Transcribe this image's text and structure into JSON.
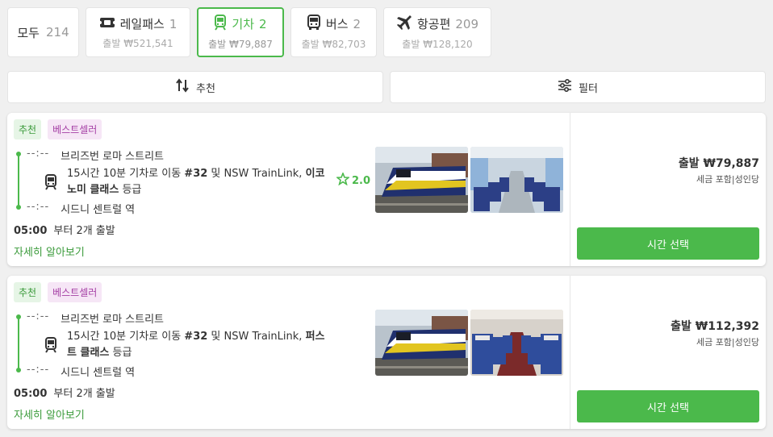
{
  "tabs": [
    {
      "label": "모두",
      "count": "214"
    },
    {
      "label": "레일패스",
      "count": "1",
      "sub": "출발 ₩521,541",
      "icon": "ticket-icon"
    },
    {
      "label": "기차",
      "count": "2",
      "sub": "출발 ₩79,887",
      "icon": "train-icon",
      "active": true
    },
    {
      "label": "버스",
      "count": "2",
      "sub": "출발 ₩82,703",
      "icon": "bus-icon"
    },
    {
      "label": "항공편",
      "count": "209",
      "sub": "출발 ₩128,120",
      "icon": "plane-icon"
    }
  ],
  "toolbar": {
    "sort_label": "추천",
    "filter_label": "필터"
  },
  "results": [
    {
      "badges": [
        "추천",
        "베스트셀러"
      ],
      "from": {
        "time": "--:--",
        "station": "브리즈번 로마 스트리트"
      },
      "to": {
        "time": "--:--",
        "station": "시드니 센트럴 역"
      },
      "journey_pre": "15시간 10분 기차로 이동 ",
      "train_no": "#32",
      "journey_mid": " 및 NSW TrainLink, ",
      "class_name": "이코노미 클래스",
      "journey_post": " 등급",
      "rating": "2.0",
      "depart_time": "05:00",
      "depart_text": "부터 2개 출발",
      "more": "자세히 알아보기",
      "price": "출발 ₩79,887",
      "price_note": "세금 포함|성인당",
      "button": "시간 선택"
    },
    {
      "badges": [
        "추천",
        "베스트셀러"
      ],
      "from": {
        "time": "--:--",
        "station": "브리즈번 로마 스트리트"
      },
      "to": {
        "time": "--:--",
        "station": "시드니 센트럴 역"
      },
      "journey_pre": "15시간 10분 기차로 이동 ",
      "train_no": "#32",
      "journey_mid": " 및 NSW TrainLink, ",
      "class_name": "퍼스트 클래스",
      "journey_post": " 등급",
      "depart_time": "05:00",
      "depart_text": "부터 2개 출발",
      "more": "자세히 알아보기",
      "price": "출발 ₩112,392",
      "price_note": "세금 포함|성인당",
      "button": "시간 선택"
    }
  ],
  "colors": {
    "accent": "#4bb94b",
    "badge_best": "#a540a5"
  }
}
